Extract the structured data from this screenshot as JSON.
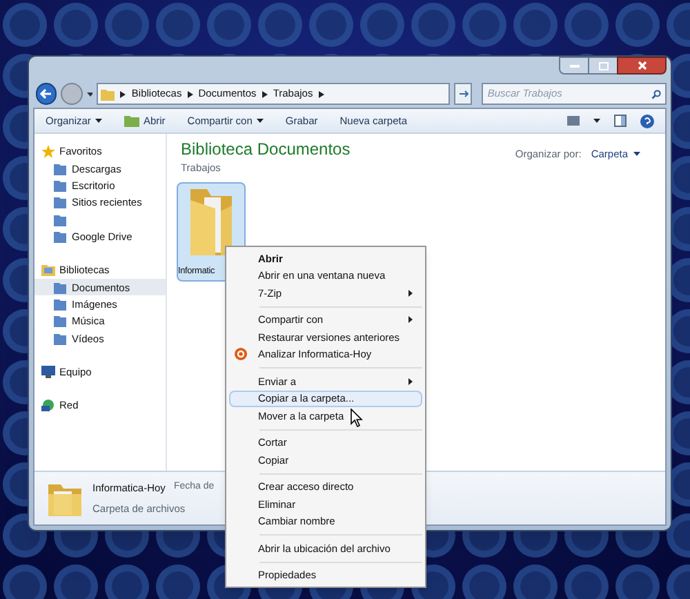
{
  "address": {
    "segments": [
      "Bibliotecas",
      "Documentos",
      "Trabajos"
    ]
  },
  "search": {
    "placeholder": "Buscar Trabajos"
  },
  "toolbar": [
    "Organizar",
    "Abrir",
    "Compartir con",
    "Grabar",
    "Nueva carpeta"
  ],
  "sidebar": {
    "groups": [
      {
        "label": "Favoritos",
        "items": [
          {
            "label": "Descargas",
            "selected": false
          },
          {
            "label": "Escritorio",
            "selected": false
          },
          {
            "label": "Sitios recientes",
            "selected": false
          },
          {
            "selected": false
          },
          {
            "label": "Google Drive",
            "selected": false
          }
        ]
      },
      {
        "label": "Bibliotecas",
        "items": [
          {
            "label": "Documentos",
            "selected": true
          },
          {
            "label": "Imágenes",
            "selected": false
          },
          {
            "label": "Música",
            "selected": false
          },
          {
            "label": "Vídeos",
            "selected": false
          }
        ]
      },
      {
        "label": "Equipo"
      },
      {
        "label": "Red"
      }
    ]
  },
  "content": {
    "title": "Biblioteca Documentos",
    "subtitle": "Trabajos",
    "arrange_label": "Organizar por:",
    "arrange_value": "Carpeta",
    "files": [
      {
        "name": "Informatic",
        "selected": true
      }
    ]
  },
  "details": {
    "name": "Informatica-Hoy",
    "type": "Carpeta de archivos",
    "field": "Fecha de"
  },
  "context_menu": [
    {
      "kind": "item",
      "label": "Abrir",
      "default": true,
      "submenu": false,
      "selected": false
    },
    {
      "kind": "item",
      "label": "Abrir en una ventana nueva",
      "default": false,
      "submenu": false,
      "selected": false
    },
    {
      "kind": "item",
      "label": "7-Zip",
      "default": false,
      "submenu": true,
      "selected": false
    },
    {
      "kind": "separator"
    },
    {
      "kind": "item",
      "label": "Compartir con",
      "default": false,
      "submenu": true,
      "selected": false
    },
    {
      "kind": "item",
      "label": "Restaurar versiones anteriores",
      "default": false,
      "submenu": false,
      "selected": false
    },
    {
      "kind": "icon_item",
      "label": "Analizar Informatica-Hoy",
      "default": false,
      "submenu": false,
      "selected": false
    },
    {
      "kind": "separator"
    },
    {
      "kind": "item",
      "label": "Enviar a",
      "default": false,
      "submenu": true,
      "selected": false
    },
    {
      "kind": "item",
      "label": "Copiar a la carpeta...",
      "default": false,
      "submenu": false,
      "selected": true
    },
    {
      "kind": "item",
      "label": "Mover a la carpeta",
      "default": false,
      "submenu": false,
      "selected": false
    },
    {
      "kind": "separator"
    },
    {
      "kind": "item",
      "label": "Cortar",
      "default": false,
      "submenu": false,
      "selected": false
    },
    {
      "kind": "item",
      "label": "Copiar",
      "default": false,
      "submenu": false,
      "selected": false
    },
    {
      "kind": "separator"
    },
    {
      "kind": "item",
      "label": "Crear acceso directo",
      "default": false,
      "submenu": false,
      "selected": false
    },
    {
      "kind": "item",
      "label": "Eliminar",
      "default": false,
      "submenu": false,
      "selected": false
    },
    {
      "kind": "item",
      "label": "Cambiar nombre",
      "default": false,
      "submenu": false,
      "selected": false
    },
    {
      "kind": "separator"
    },
    {
      "kind": "item",
      "label": "Abrir la ubicación del archivo",
      "default": false,
      "submenu": false,
      "selected": false
    },
    {
      "kind": "separator"
    },
    {
      "kind": "item",
      "label": "Propiedades",
      "default": false,
      "submenu": false,
      "selected": false
    }
  ]
}
